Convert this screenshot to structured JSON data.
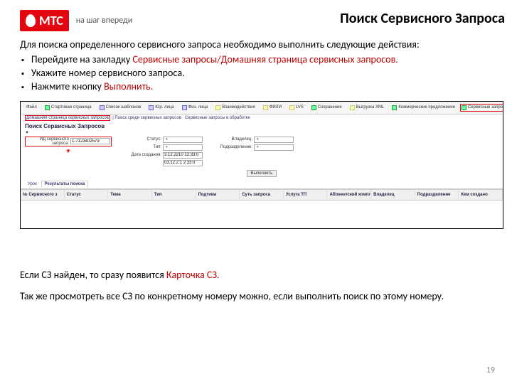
{
  "logo": {
    "text": "МТС",
    "tagline": "на шаг впереди"
  },
  "title": "Поиск Сервисного Запроса",
  "intro": "Для поиска определенного сервисного запроса необходимо выполнить следующие действия:",
  "bullets": {
    "b1_a": "Перейдите на закладку ",
    "b1_b": "Сервисные запросы/Домашняя страница сервисных запросов.",
    "b2": "Укажите номер сервисного запроса.",
    "b3_a": "Нажмите кнопку ",
    "b3_b": "Выполнить."
  },
  "shot": {
    "toolbar": [
      "Файл",
      "Стартовая страница",
      "Список шаблонов",
      "Юр. лица",
      "Физ. лица",
      "Взаимодействия",
      "ФИЛИ",
      "LVS",
      "Сохранение",
      "Выгрузка XML",
      "Коммерческие предложения"
    ],
    "toolbar_highlight": "Сервисные запросы",
    "breadcrumb_a": "Домашняя страница сервисных запросов",
    "breadcrumb_b": "Поиск среди сервисных запросов",
    "breadcrumb_c": "Сервисные запросы в обработке",
    "section": "Поиск Сервисных Запросов",
    "filter_labels": {
      "id": "ИД сервисного запроса:",
      "id_val": "1-7123402579",
      "status": "Статус:",
      "owner": "Владелец:",
      "type": "Тип:",
      "subdiv": "Подразделение:",
      "date": "Дата создания:",
      "date_val": "3.12.2210 12:33:0",
      "date_val2": "03.12.2.1 2:33:0"
    },
    "exec_btn": "Выполнить",
    "tab_a": "Урок",
    "tab_b": "Результаты поиска",
    "cols": [
      "№ Сервисного з",
      "Статус",
      "Тема",
      "Тип",
      "Подтема",
      "Суть запроса",
      "Услуга ТП",
      "Абонентский комплект",
      "Владелец",
      "Подразделение",
      "Кем создано"
    ]
  },
  "after": {
    "p1_a": "Если СЗ найден, то сразу появится ",
    "p1_b": "Карточка СЗ.",
    "p2": "Так же просмотреть все СЗ по конкретному номеру можно, если выполнить поиск по этому номеру."
  },
  "pagenum": "19"
}
